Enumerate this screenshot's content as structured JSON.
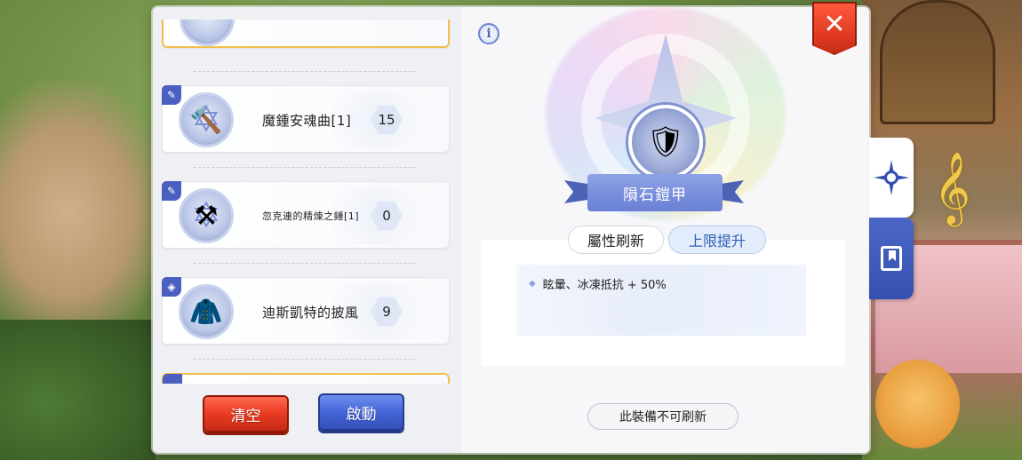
{
  "item_list": [
    {
      "name": "魔鍾安魂曲[1]",
      "count": "15",
      "category_icon": "weapon-icon",
      "item_icon": "hammer-icon"
    },
    {
      "name": "忽克連的精煉之錘[1]",
      "count": "0",
      "category_icon": "weapon-icon",
      "item_icon": "golden-hammer-icon"
    },
    {
      "name": "迪斯凱特的披風",
      "count": "9",
      "category_icon": "armor-icon",
      "item_icon": "cloak-icon"
    }
  ],
  "buttons": {
    "clear": "清空",
    "activate": "啟動"
  },
  "detail": {
    "info_icon": "i",
    "equipment_name": "隕石鎧甲",
    "tabs": {
      "attribute_refresh": "屬性刷新",
      "limit_raise": "上限提升"
    },
    "stat_line": "眩暈、冰凍抵抗 + 50%",
    "refresh_status": "此裝備不可刷新"
  },
  "close_label": "✕",
  "colors": {
    "accent_blue": "#4a67c8",
    "close_red": "#e23c22",
    "selected_border": "#f2c04a"
  }
}
